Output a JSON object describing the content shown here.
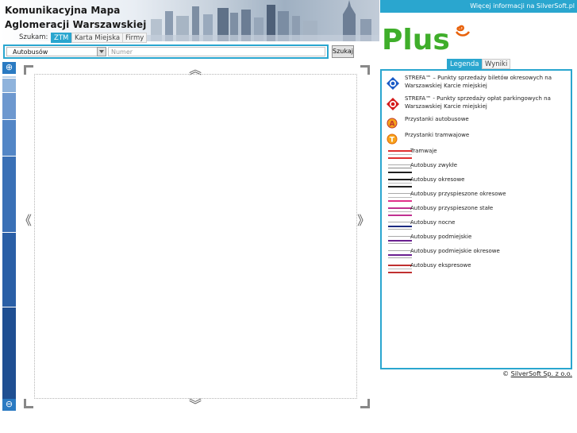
{
  "header": {
    "title_line1": "Komunikacyjna Mapa",
    "title_line2": "Aglomeracji Warszawskiej"
  },
  "search": {
    "label": "Szukam:",
    "tabs": [
      "ZTM",
      "Karta Miejska",
      "Firmy"
    ],
    "active_tab": "ZTM",
    "select_value": "Autobusów",
    "number_placeholder": "Numer",
    "button_label": "Szukaj"
  },
  "map": {
    "nav_up": "︽",
    "nav_down": "︾",
    "nav_left": "《",
    "nav_right": "》",
    "zoom_in": "⊕",
    "zoom_out": "⊖"
  },
  "panel": {
    "top_link": "Więcej informacji na SilverSoft.pl",
    "logo_text": "Plus",
    "tabs": [
      "Legenda",
      "Wyniki"
    ],
    "active_tab": "Legenda",
    "legend": [
      {
        "kind": "icon",
        "icon": "strefa-blue-icon",
        "text": "STREFA™ – Punkty sprzedaży biletów okresowych na Warszawskiej Karcie miejskiej"
      },
      {
        "kind": "icon",
        "icon": "strefa-red-icon",
        "text": "STREFA™ - Punkty sprzedaży opłat parkingowych na Warszawskiej Karcie miejskiej"
      },
      {
        "kind": "icon",
        "icon": "bus-stop-icon",
        "text": "Przystanki autobusowe"
      },
      {
        "kind": "icon",
        "icon": "tram-stop-icon",
        "text": "Przystanki tramwajowe"
      },
      {
        "kind": "line",
        "colors": [
          "#e03030",
          "#e03030"
        ],
        "text": "Tramwaje"
      },
      {
        "kind": "line",
        "colors": [
          "#222222",
          "#222222"
        ],
        "text": "Autobusy zwykłe"
      },
      {
        "kind": "line",
        "colors": [
          "#222222",
          "#222222"
        ],
        "text": "Autobusy okresowe"
      },
      {
        "kind": "line",
        "colors": [
          "#e0308a",
          "#e0308a"
        ],
        "text": "Autobusy przyspieszone okresowe"
      },
      {
        "kind": "line",
        "colors": [
          "#c03090",
          "#c03090"
        ],
        "text": "Autobusy przyspieszone stałe"
      },
      {
        "kind": "line",
        "colors": [
          "#1c2a80",
          "#1c2a80"
        ],
        "text": "Autobusy nocne"
      },
      {
        "kind": "line",
        "colors": [
          "#6a2090",
          "#6a2090"
        ],
        "text": "Autobusy podmiejskie"
      },
      {
        "kind": "line",
        "colors": [
          "#6a2090",
          "#6a2090"
        ],
        "text": "Autobusy podmiejskie okresowe"
      },
      {
        "kind": "line",
        "colors": [
          "#c03030",
          "#c03030"
        ],
        "text": "Autobusy ekspresowe"
      }
    ],
    "copyright_prefix": "© ",
    "copyright_link": "SilverSoft Sp. z o.o."
  },
  "colors": {
    "accent": "#2aa6cf",
    "zoom": "#2a7ac2",
    "logo_green": "#3fae2a",
    "logo_orange": "#e8620c"
  }
}
